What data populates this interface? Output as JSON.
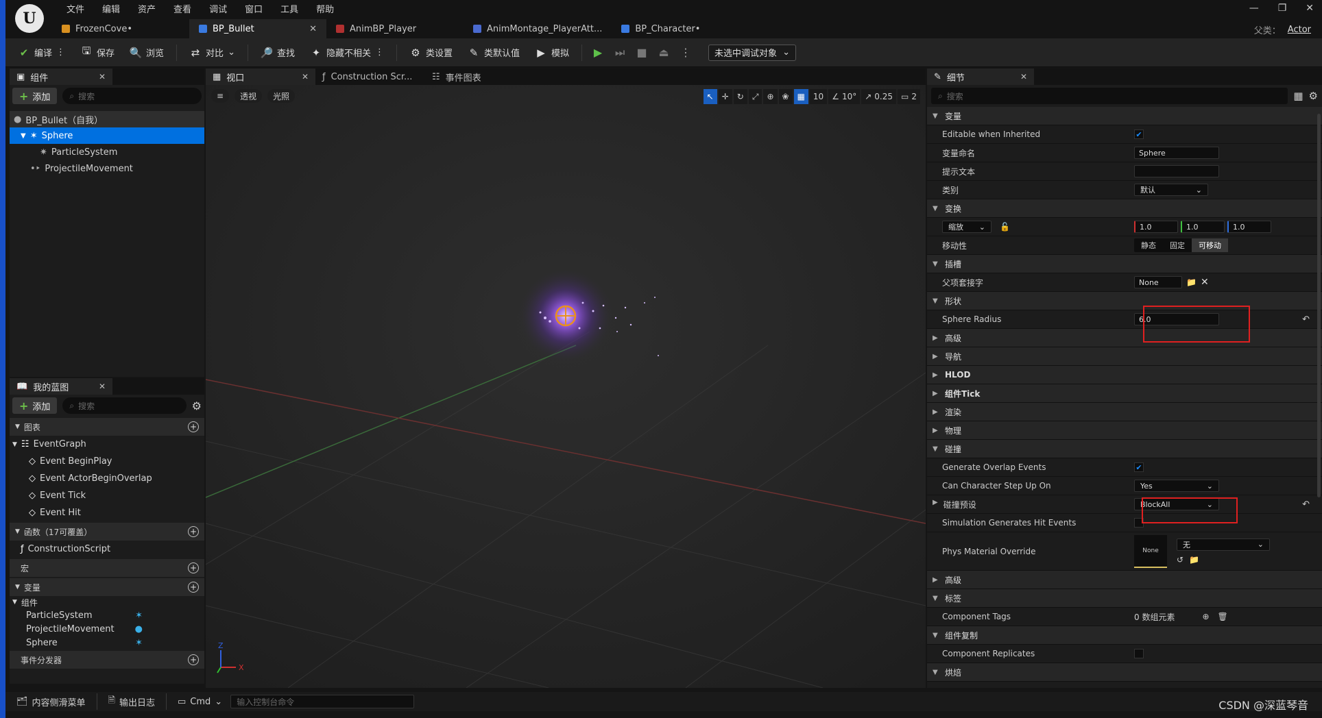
{
  "menu": [
    "文件",
    "编辑",
    "资产",
    "查看",
    "调试",
    "窗口",
    "工具",
    "帮助"
  ],
  "doc_tabs": [
    {
      "label": "FrozenCove•",
      "color": "#d89020",
      "active": false
    },
    {
      "label": "BP_Bullet",
      "color": "#3a7ae0",
      "active": true
    },
    {
      "label": "AnimBP_Player",
      "color": "#b03030",
      "active": false
    },
    {
      "label": "AnimMontage_PlayerAtt...",
      "color": "#4a6ad0",
      "active": false
    },
    {
      "label": "BP_Character•",
      "color": "#3a7ae0",
      "active": false
    }
  ],
  "parent_class": {
    "label": "父类：",
    "value": "Actor"
  },
  "toolbar": {
    "compile": "编译",
    "save": "保存",
    "browse": "浏览",
    "diff": "对比",
    "find": "查找",
    "hide_unrelated": "隐藏不相关",
    "class_settings": "类设置",
    "class_defaults": "类默认值",
    "simulate": "模拟",
    "debug_target": "未选中调试对象"
  },
  "components_panel": {
    "title": "组件",
    "add": "添加",
    "search_placeholder": "搜索",
    "items": [
      {
        "label": "BP_Bullet（自我）",
        "level": 0
      },
      {
        "label": "Sphere",
        "level": 1
      },
      {
        "label": "ParticleSystem",
        "level": 2
      },
      {
        "label": "ProjectileMovement",
        "level": 1
      }
    ]
  },
  "blueprint_panel": {
    "title": "我的蓝图",
    "add": "添加",
    "search_placeholder": "搜索",
    "graphs_section": "图表",
    "event_graph": "EventGraph",
    "events": [
      "Event BeginPlay",
      "Event ActorBeginOverlap",
      "Event Tick",
      "Event Hit"
    ],
    "functions_section": "函数（17可覆盖）",
    "construction_script": "ConstructionScript",
    "macros_section": "宏",
    "variables_section": "变量",
    "components_group": "组件",
    "variables": [
      "ParticleSystem",
      "ProjectileMovement",
      "Sphere"
    ],
    "dispatchers_section": "事件分发器"
  },
  "editor_tabs": [
    "视口",
    "Construction Scr...",
    "事件图表"
  ],
  "viewport": {
    "perspective": "透视",
    "lit": "光照",
    "grid_size": "10",
    "rot_snap": "10°",
    "scale_snap": "0.25",
    "cam_speed": "2",
    "axis_x": "X",
    "axis_z": "Z"
  },
  "details": {
    "title": "细节",
    "search_placeholder": "搜索",
    "sec_variable": "变量",
    "editable_inherited": "Editable when Inherited",
    "var_name_label": "变量命名",
    "var_name": "Sphere",
    "tooltip_label": "提示文本",
    "category_label": "类别",
    "category": "默认",
    "sec_transform": "变换",
    "scale_label": "缩放",
    "scale_x": "1.0",
    "scale_y": "1.0",
    "scale_z": "1.0",
    "mobility_label": "移动性",
    "mob_static": "静态",
    "mob_stationary": "固定",
    "mob_movable": "可移动",
    "sec_sockets": "插槽",
    "parent_socket_label": "父项套接字",
    "parent_socket": "None",
    "sec_shape": "形状",
    "sphere_radius_label": "Sphere Radius",
    "sphere_radius": "6.0",
    "sec_advanced": "高级",
    "sec_nav": "导航",
    "sec_hlod": "HLOD",
    "sec_tick": "组件Tick",
    "sec_render": "渲染",
    "sec_physics": "物理",
    "sec_collision": "碰撞",
    "gen_overlap": "Generate Overlap Events",
    "step_up": "Can Character Step Up On",
    "step_up_val": "Yes",
    "collision_preset_label": "碰撞预设",
    "collision_preset": "BlockAll",
    "sim_hit": "Simulation Generates Hit Events",
    "phys_mat": "Phys Material Override",
    "phys_mat_thumb": "None",
    "phys_mat_val": "无",
    "sec_advanced2": "高级",
    "sec_tags": "标签",
    "component_tags": "Component Tags",
    "component_tags_val": "0 数组元素",
    "sec_replication": "组件复制",
    "component_replicates": "Component Replicates",
    "sec_cook": "烘焙"
  },
  "statusbar": {
    "content_drawer": "内容侧滑菜单",
    "output_log": "输出日志",
    "cmd": "Cmd",
    "console_placeholder": "输入控制台命令",
    "watermark": "CSDN @深蓝琴音"
  }
}
